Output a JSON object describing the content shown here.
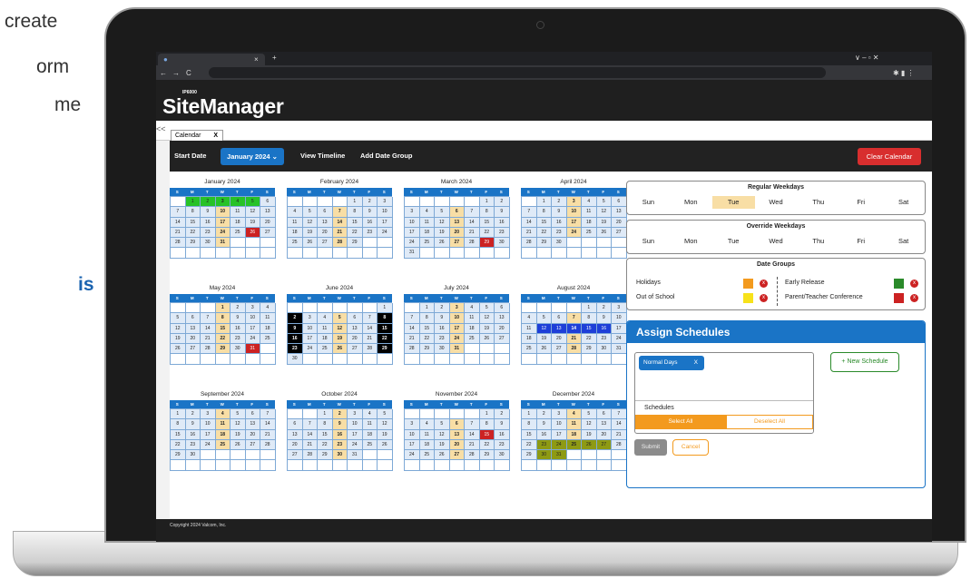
{
  "marketing": {
    "lines": [
      "create",
      "orm",
      "me",
      "is"
    ]
  },
  "browser": {
    "tab_close": "×",
    "new_tab": "+",
    "back": "←",
    "forward": "→",
    "reload": "C",
    "window_controls": "∨  –  ▫  ✕"
  },
  "app": {
    "product_tag": "IP6000",
    "title": "SiteManager",
    "collapse": "<<",
    "tab_label": "Calendar",
    "tab_close": "X"
  },
  "toolbar": {
    "start_date": "Start Date",
    "month_button": "January 2024",
    "view_timeline": "View Timeline",
    "add_date_group": "Add Date Group",
    "clear_calendar": "Clear Calendar"
  },
  "colors": {
    "accent": "#1a74c6",
    "danger": "#d82e2e",
    "highlight": "#f8dea5",
    "holiday": "#f39a1e",
    "out_of_school": "#f7e21b",
    "early_release": "#2a8a2a",
    "conference": "#cc2222"
  },
  "weekday_header": [
    "S",
    "M",
    "T",
    "W",
    "T",
    "F",
    "S"
  ],
  "months": [
    {
      "name": "January 2024",
      "start": 1,
      "days": 31,
      "green": [
        1,
        2,
        3,
        4,
        5
      ],
      "red": [
        26
      ],
      "black": [],
      "blue": [],
      "olive": []
    },
    {
      "name": "February 2024",
      "start": 4,
      "days": 29,
      "green": [],
      "red": [],
      "black": [],
      "blue": [],
      "olive": []
    },
    {
      "name": "March 2024",
      "start": 5,
      "days": 31,
      "green": [],
      "red": [
        29
      ],
      "black": [],
      "blue": [],
      "olive": []
    },
    {
      "name": "April 2024",
      "start": 1,
      "days": 30,
      "green": [],
      "red": [],
      "black": [],
      "blue": [],
      "olive": []
    },
    {
      "name": "May 2024",
      "start": 3,
      "days": 31,
      "green": [],
      "red": [
        31
      ],
      "black": [],
      "blue": [],
      "olive": []
    },
    {
      "name": "June 2024",
      "start": 6,
      "days": 30,
      "green": [],
      "red": [],
      "black": [
        2,
        8,
        9,
        15,
        16,
        22,
        23,
        29
      ],
      "blue": [],
      "olive": []
    },
    {
      "name": "July 2024",
      "start": 1,
      "days": 31,
      "green": [],
      "red": [],
      "black": [],
      "blue": [],
      "olive": []
    },
    {
      "name": "August 2024",
      "start": 4,
      "days": 31,
      "green": [],
      "red": [],
      "black": [],
      "blue": [
        12,
        13,
        14,
        15,
        16
      ],
      "olive": []
    },
    {
      "name": "September 2024",
      "start": 0,
      "days": 30,
      "green": [],
      "red": [],
      "black": [],
      "blue": [],
      "olive": []
    },
    {
      "name": "October 2024",
      "start": 2,
      "days": 31,
      "green": [],
      "red": [],
      "black": [],
      "blue": [],
      "olive": []
    },
    {
      "name": "November 2024",
      "start": 5,
      "days": 30,
      "green": [],
      "red": [
        15
      ],
      "black": [],
      "blue": [],
      "olive": []
    },
    {
      "name": "December 2024",
      "start": 0,
      "days": 31,
      "green": [],
      "red": [],
      "black": [],
      "blue": [],
      "olive": [
        23,
        24,
        25,
        26,
        27,
        30,
        31
      ]
    }
  ],
  "regular_weekdays": {
    "title": "Regular Weekdays",
    "days": [
      "Sun",
      "Mon",
      "Tue",
      "Wed",
      "Thu",
      "Fri",
      "Sat"
    ],
    "selected": "Tue"
  },
  "override_weekdays": {
    "title": "Override Weekdays",
    "days": [
      "Sun",
      "Mon",
      "Tue",
      "Wed",
      "Thu",
      "Fri",
      "Sat"
    ]
  },
  "date_groups": {
    "title": "Date Groups",
    "holidays": "Holidays",
    "out_of_school": "Out of School",
    "early_release": "Early Release",
    "conference": "Parent/Teacher Conference",
    "remove": "x"
  },
  "assign": {
    "title": "Assign Schedules",
    "chip": "Normal Days",
    "chip_close": "X",
    "schedules_label": "Schedules",
    "select_all": "Select All",
    "deselect_all": "Deselect All",
    "new_schedule": "+ New Schedule",
    "submit": "Submit",
    "cancel": "Cancel"
  },
  "footer": {
    "copyright": "Copyright 2024 Valcom, Inc."
  }
}
